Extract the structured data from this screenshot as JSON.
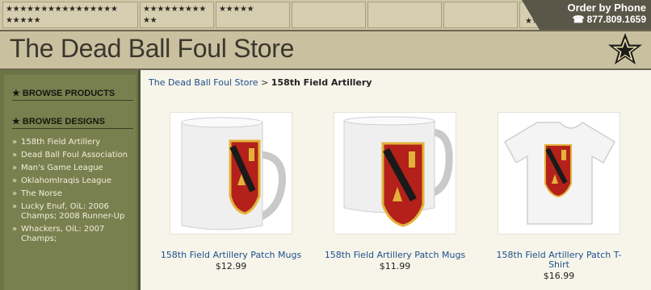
{
  "header": {
    "star_rows": [
      "★★★★★★★★★★★★★★★★\n★★★★★",
      "★★★★★★★★★\n★★",
      "★★★★★",
      "",
      "",
      "",
      "★★★"
    ],
    "phone_label": "Order by Phone",
    "phone_number": "877.809.1659",
    "phone_icon": "phone-icon",
    "site_title": "The Dead Ball Foul Store",
    "logo_icon": "army-star-icon"
  },
  "sidebar": {
    "browse_products": "BROWSE PRODUCTS",
    "browse_designs": "BROWSE DESIGNS",
    "designs": [
      "158th Field Artillery",
      "Dead Ball Foul Association",
      "Man's Game League",
      "OklahomIraqis League",
      "The Norse",
      "Lucky Enuf, OiL: 2006 Champs; 2008 Runner-Up",
      "Whackers, OiL: 2007 Champs;"
    ]
  },
  "breadcrumb": {
    "home": "The Dead Ball Foul Store",
    "separator": ">",
    "current": "158th Field Artillery"
  },
  "products": [
    {
      "name": "158th Field Artillery Patch Mugs",
      "price": "$12.99",
      "kind": "large-mug"
    },
    {
      "name": "158th Field Artillery Patch Mugs",
      "price": "$11.99",
      "kind": "mug"
    },
    {
      "name": "158th Field Artillery Patch T-Shirt",
      "price": "$16.99",
      "kind": "tshirt"
    }
  ],
  "colors": {
    "link": "#1d4f8c",
    "sidebar": "#79804f",
    "patch_red": "#b3211a",
    "patch_gold": "#e2b23a"
  }
}
